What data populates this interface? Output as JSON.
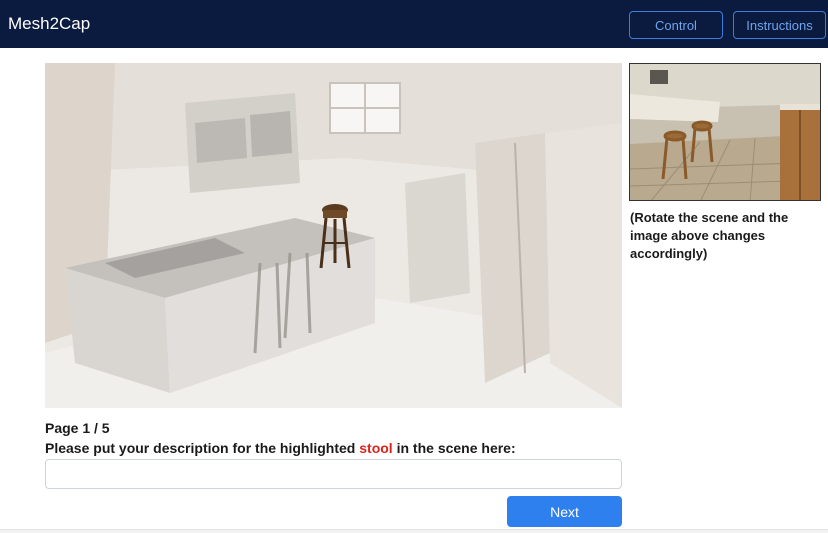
{
  "navbar": {
    "brand": "Mesh2Cap",
    "control_label": "Control",
    "instructions_label": "Instructions",
    "background": "#0b1a3f",
    "button_accent": "#3f7cd8"
  },
  "scene": {
    "note": "(Rotate the scene and the image above changes accordingly)"
  },
  "task": {
    "page_indicator": "Page 1 / 5",
    "prompt_before": "Please put your description for the highlighted ",
    "highlighted_object": "stool",
    "prompt_after": " in the scene here:",
    "highlight_color": "#d7261e",
    "input_value": "",
    "input_placeholder": ""
  },
  "actions": {
    "next_label": "Next",
    "next_color": "#2f80ef"
  }
}
